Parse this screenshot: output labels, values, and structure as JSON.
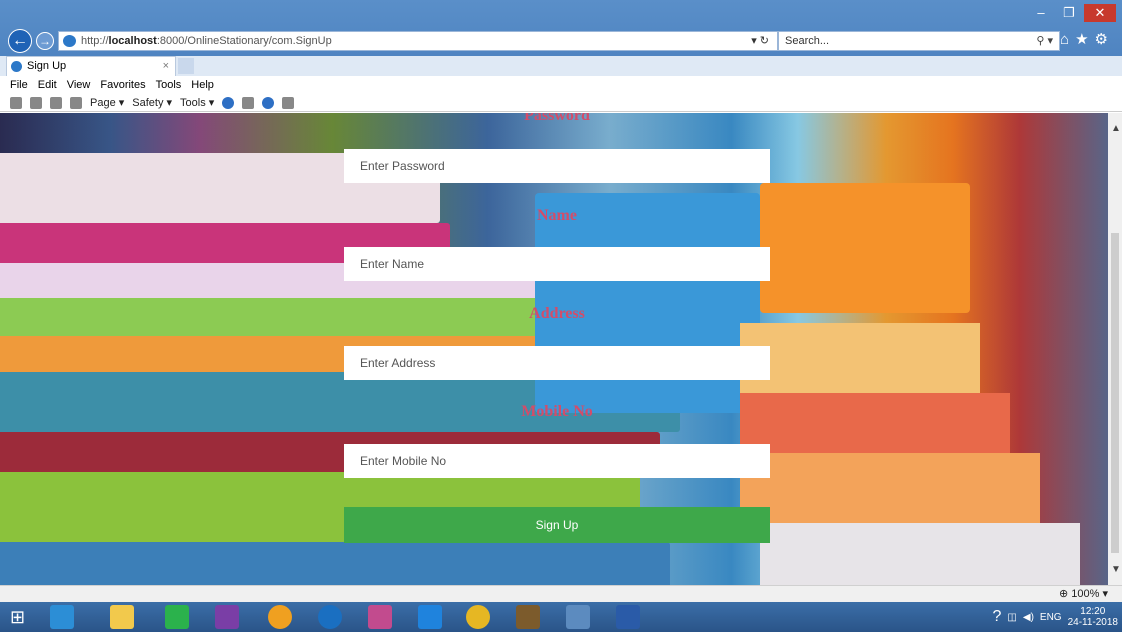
{
  "browser": {
    "url_prefix": "http://",
    "url_host": "localhost",
    "url_rest": ":8000/OnlineStationary/com.SignUp",
    "search_placeholder": "Search...",
    "tab_title": "Sign Up",
    "menu": [
      "File",
      "Edit",
      "View",
      "Favorites",
      "Tools",
      "Help"
    ],
    "commands": [
      "Page ▾",
      "Safety ▾",
      "Tools ▾"
    ],
    "zoom": "100%"
  },
  "form": {
    "password_label": "Password",
    "password_placeholder": "Enter Password",
    "name_label": "Name",
    "name_placeholder": "Enter Name",
    "address_label": "Address",
    "address_placeholder": "Enter Address",
    "mobile_label": "Mobile No",
    "mobile_placeholder": "Enter Mobile No",
    "submit_label": "Sign Up"
  },
  "taskbar": {
    "lang": "ENG",
    "time": "12:20",
    "date": "24-11-2018"
  },
  "colors": {
    "label": "#d24d6a",
    "button": "#3ea84a"
  }
}
